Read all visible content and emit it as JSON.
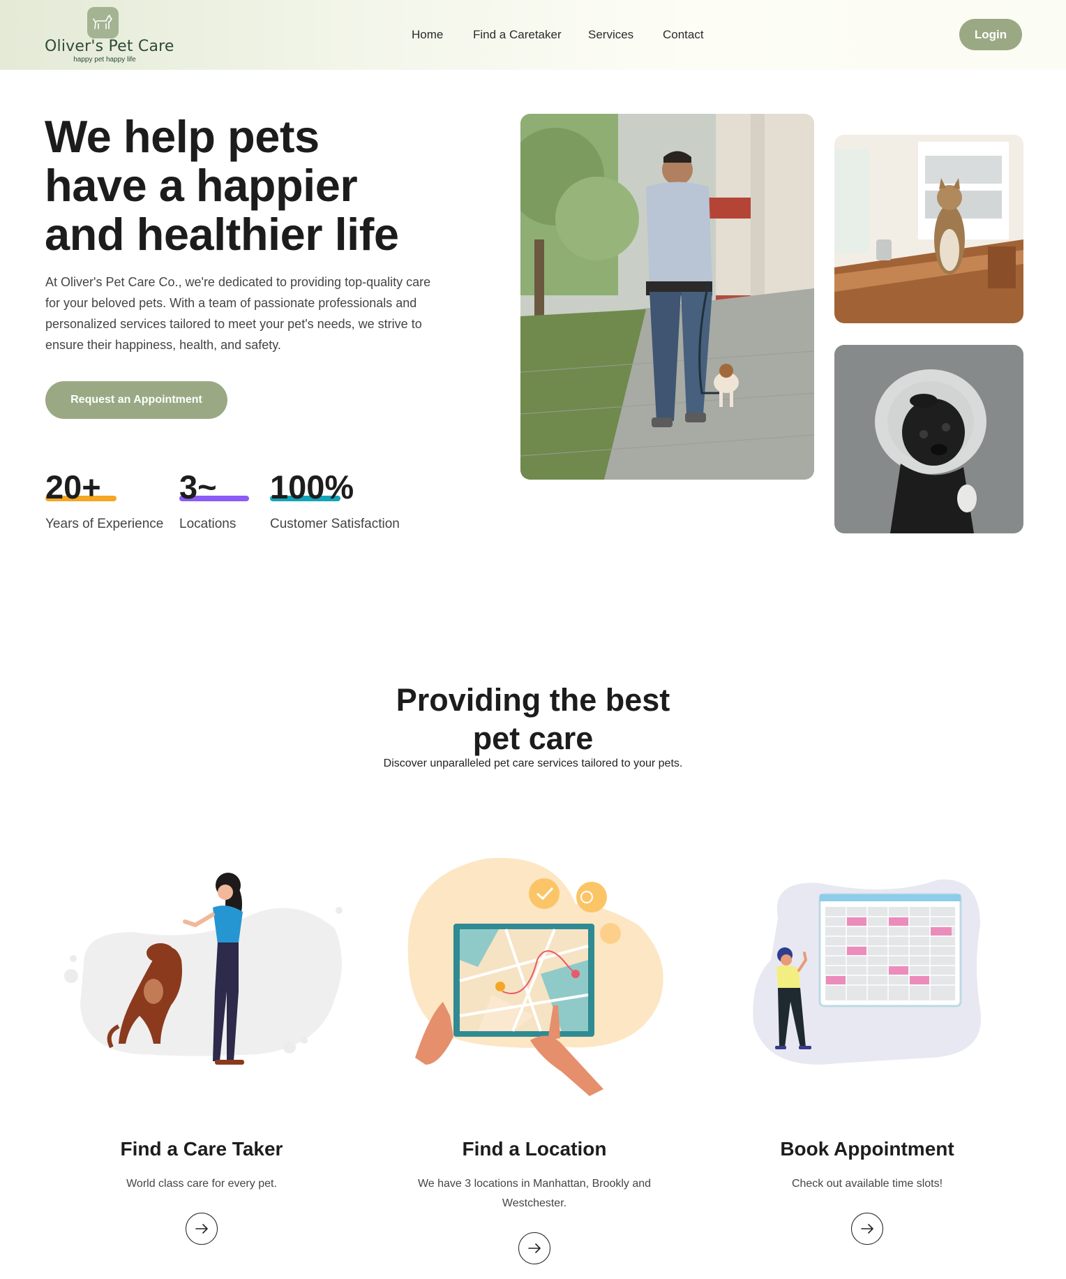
{
  "header": {
    "logo_name": "Oliver's Pet Care",
    "logo_tagline": "happy pet happy life",
    "nav": [
      {
        "label": "Home"
      },
      {
        "label": "Find a Caretaker"
      },
      {
        "label": "Services"
      },
      {
        "label": "Contact"
      }
    ],
    "login_label": "Login"
  },
  "hero": {
    "title_lines": [
      "We help pets",
      "have a happier",
      "and healthier life"
    ],
    "description_lines": [
      "At Oliver's Pet Care Co., we're dedicated to providing top-quality care",
      "for your beloved pets. With a team of passionate professionals and",
      "personalized services tailored to meet your pet's needs, we strive to",
      "ensure their happiness, health, and safety."
    ],
    "cta_label": "Request an Appointment",
    "stats": [
      {
        "value": "20+",
        "label": "Years of Experience",
        "color": "#f5a623"
      },
      {
        "value": "3~",
        "label": "Locations",
        "color": "#8b5cf6"
      },
      {
        "value": "100%",
        "label": "Customer Satisfaction",
        "color": "#14a3b8"
      }
    ]
  },
  "services": {
    "title_lines": [
      "Providing the best",
      "pet care"
    ],
    "subtitle": "Discover unparalleled pet care services tailored to your pets.",
    "cards": [
      {
        "title": "Find a Care Taker",
        "description": "World class care for every pet."
      },
      {
        "title": "Find a Location",
        "description": "We have 3 locations in Manhattan, Brookly and Westchester."
      },
      {
        "title": "Book Appointment",
        "description": "Check out available time slots!"
      }
    ]
  },
  "colors": {
    "accent": "#9aa984",
    "brand_text": "#2f4a38"
  },
  "icons": [
    "dog-logo-icon",
    "arrow-right-icon"
  ]
}
